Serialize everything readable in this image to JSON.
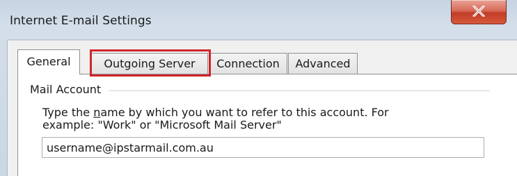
{
  "window": {
    "title": "Internet E-mail Settings",
    "close_icon": "close-x-icon"
  },
  "tabs": [
    {
      "label": "General",
      "active": true
    },
    {
      "label": "Outgoing Server",
      "active": false,
      "highlighted": true
    },
    {
      "label": "Connection",
      "active": false
    },
    {
      "label": "Advanced",
      "active": false
    }
  ],
  "mail_account": {
    "group_label": "Mail Account",
    "help_line1_pre": "Type the ",
    "help_line1_mnemonic": "n",
    "help_line1_post": "ame by which you want to refer to this account. For",
    "help_line2": "example: \"Work\" or \"Microsoft Mail Server\"",
    "account_name_value": "username@ipstarmail.com.au"
  },
  "colors": {
    "highlight": "#d0252b",
    "close_button": "#c13c26"
  }
}
